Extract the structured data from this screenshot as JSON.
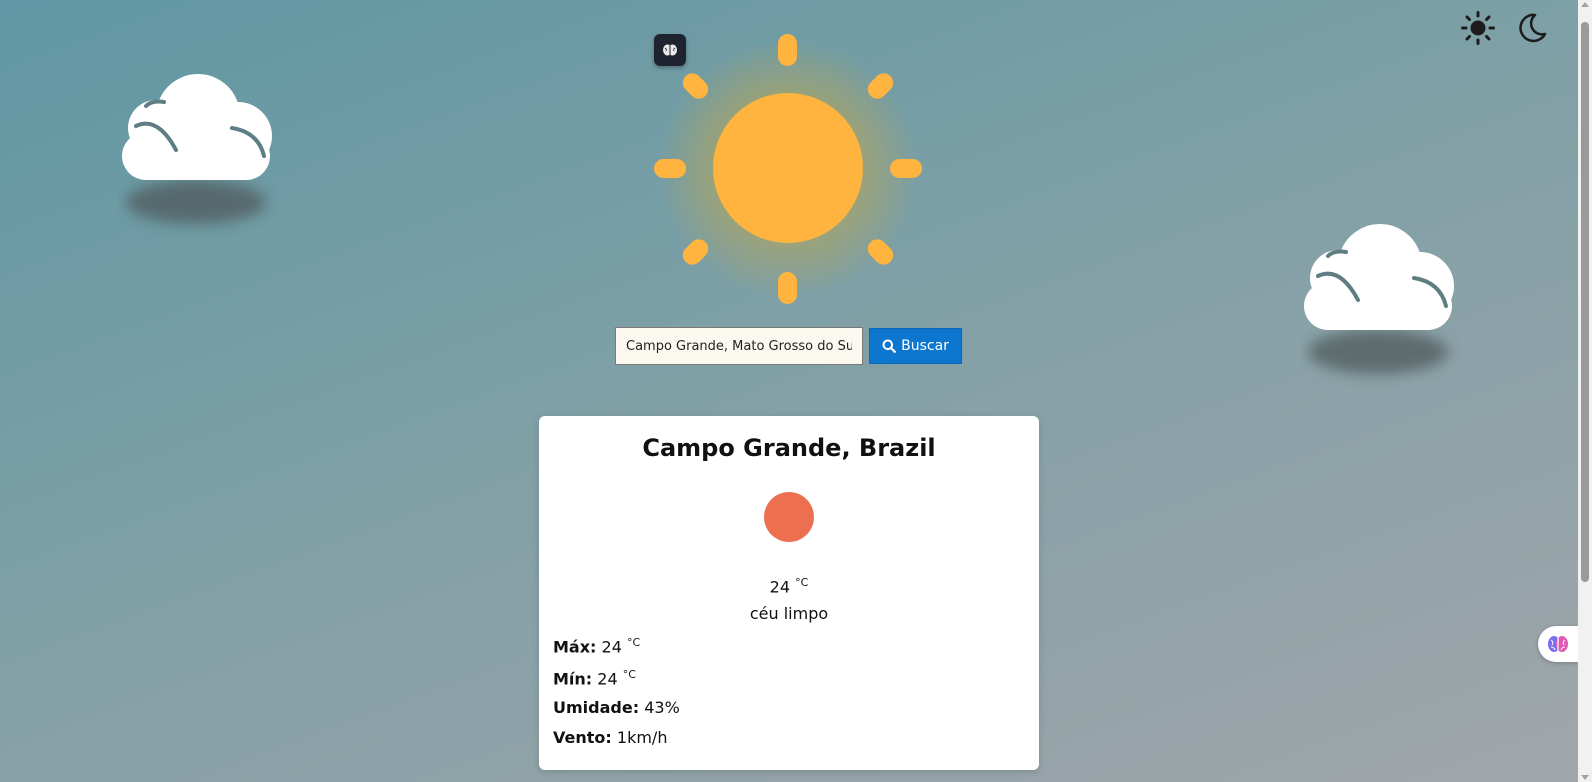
{
  "search": {
    "value": "Campo Grande, Mato Grosso do Sul",
    "button_label": "Buscar"
  },
  "weather": {
    "city": "Campo Grande, Brazil",
    "temp": "24",
    "unit": "°C",
    "description": "céu limpo",
    "max_label": "Máx:",
    "max_value": "24",
    "min_label": "Mín:",
    "min_value": "24",
    "humidity_label": "Umidade:",
    "humidity_value": "43%",
    "wind_label": "Vento:",
    "wind_value": "1km/h"
  },
  "colors": {
    "sun": "#ffb43f",
    "weather_icon": "#ec704f",
    "button": "#0d77d0"
  },
  "icons": [
    "sun-icon",
    "moon-icon",
    "brain-icon",
    "search-icon",
    "cloud-icon"
  ]
}
